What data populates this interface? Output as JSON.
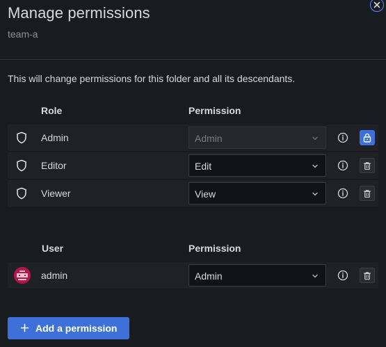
{
  "drawer": {
    "title": "Manage permissions",
    "subtitle": "team-a"
  },
  "notice": "This will change permissions for this folder and all its descendants.",
  "roles_section": {
    "col_role": "Role",
    "col_permission": "Permission",
    "rows": [
      {
        "name": "Admin",
        "permission": "Admin",
        "locked": true
      },
      {
        "name": "Editor",
        "permission": "Edit",
        "locked": false
      },
      {
        "name": "Viewer",
        "permission": "View",
        "locked": false
      }
    ]
  },
  "users_section": {
    "col_user": "User",
    "col_permission": "Permission",
    "rows": [
      {
        "name": "admin",
        "permission": "Admin"
      }
    ]
  },
  "add_button": {
    "label": "Add a permission"
  },
  "icons": {
    "role": "shield-icon",
    "info": "info-icon",
    "lock": "lock-icon",
    "trash": "trash-icon",
    "close": "close-icon",
    "chevron": "chevron-down-icon",
    "plus": "plus-icon"
  },
  "colors": {
    "background": "#181b1f",
    "row_background": "#1f2126",
    "accent": "#3d71d9",
    "avatar": "#b3174a"
  }
}
